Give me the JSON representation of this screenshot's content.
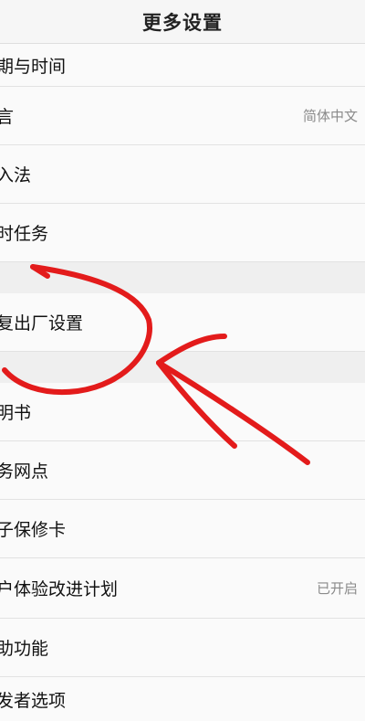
{
  "header": {
    "title": "更多设置"
  },
  "group1": [
    {
      "label": "期与时间",
      "value": ""
    },
    {
      "label": "言",
      "value": "简体中文"
    },
    {
      "label": "入法",
      "value": ""
    },
    {
      "label": "时任务",
      "value": ""
    }
  ],
  "group2": [
    {
      "label": "复出厂设置",
      "value": ""
    }
  ],
  "group3": [
    {
      "label": "明书",
      "value": ""
    },
    {
      "label": "务网点",
      "value": ""
    },
    {
      "label": "子保修卡",
      "value": ""
    },
    {
      "label": "户体验改进计划",
      "value": "已开启"
    },
    {
      "label": "助功能",
      "value": ""
    },
    {
      "label": "发者选项",
      "value": ""
    }
  ],
  "annotation": {
    "color": "#e31b1b"
  }
}
